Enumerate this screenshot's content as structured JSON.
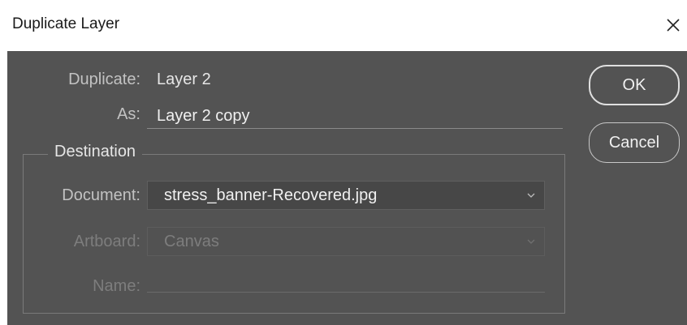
{
  "window": {
    "title": "Duplicate Layer"
  },
  "form": {
    "duplicate_label": "Duplicate:",
    "duplicate_value": "Layer 2",
    "as_label": "As:",
    "as_value": "Layer 2 copy",
    "destination_legend": "Destination",
    "document_label": "Document:",
    "document_value": "stress_banner-Recovered.jpg",
    "artboard_label": "Artboard:",
    "artboard_value": "Canvas",
    "name_label": "Name:",
    "name_value": ""
  },
  "buttons": {
    "ok_label": "OK",
    "cancel_label": "Cancel"
  },
  "colors": {
    "panel_bg": "#535353",
    "label": "#c2c2c2",
    "disabled": "#7d7d7d",
    "text": "#f0f0f0"
  },
  "icons": {
    "close": "close-icon",
    "dropdown": "chevron-down-icon"
  }
}
